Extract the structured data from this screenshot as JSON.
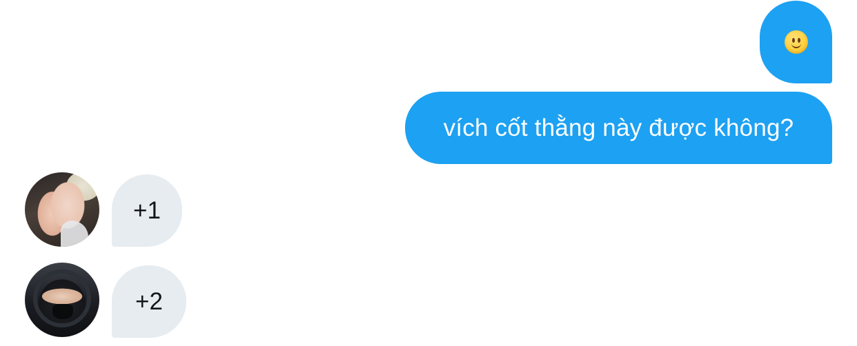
{
  "conversation": {
    "sent": [
      {
        "type": "emoji",
        "emoji": "🙂",
        "emoji_name": "slightly-smiling-face-icon"
      },
      {
        "type": "text",
        "text": "vích cốt thằng này được không?"
      }
    ],
    "received": [
      {
        "text": "+1",
        "avatar": "user-avatar-hands"
      },
      {
        "text": "+2",
        "avatar": "user-avatar-helmet"
      }
    ]
  },
  "colors": {
    "sent_bubble": "#1DA1F2",
    "received_bubble": "#E6ECF0",
    "sent_text": "#FFFFFF",
    "received_text": "#14171A"
  }
}
